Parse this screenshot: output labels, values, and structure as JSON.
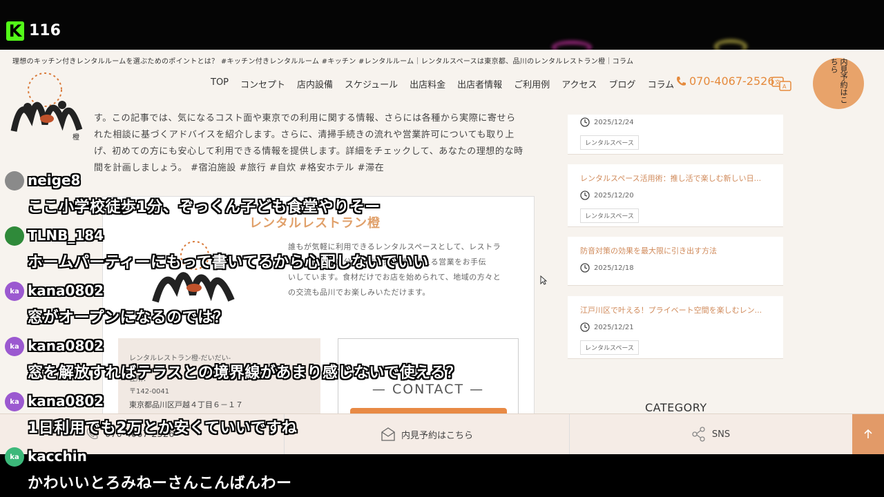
{
  "stream": {
    "viewer_count": "116",
    "logo_letter": "K"
  },
  "site": {
    "breadcrumb": "理想のキッチン付きレンタルルームを選ぶためのポイントとは？ #キッチン付きレンタルルーム #キッチン #レンタルルーム｜レンタルスペースは東京都、品川のレンタルレストラン橙｜コラム",
    "logo_char": "橙",
    "nav": [
      "TOP",
      "コンセプト",
      "店内設備",
      "スケジュール",
      "出店料金",
      "出店者情報",
      "ご利用例",
      "アクセス",
      "ブログ",
      "コラム"
    ],
    "phone": "070-4067-2526",
    "visit_circle": "内見予約はこちら",
    "article_lines": [
      "す。この記事では、気になるコスト面や東京での利用に関する情報、さらには各種から実際に寄せら",
      "れた相談に基づくアドバイスを紹介します。さらに、清掃手続きの流れや営業許可についても取り上",
      "げ、初めての方にも安心して利用できる情報を提供します。詳細をチェックして、あなたの理想的な時",
      "間を計画しましょう。 #宿泊施設 #旅行 #自炊 #格安ホテル #滞在"
    ],
    "shop_card": {
      "title": "レンタルレストラン橙",
      "desc_lines": [
        "誰もが気軽に利用できるレンタルスペースとして、レストラ",
        "ンを出店し、自分のお店を持つ夢を叶える営業をお手伝",
        "いしています。食材だけでお店を始められて、地域の方々と",
        "の交流も品川でお楽しみいただけます。"
      ],
      "addr_name": "レンタルレストラン橙-だいだい-",
      "addr_label": "住所：",
      "addr_zip": "〒142-0041",
      "addr_line": "東京都品川区戸越４丁目６－１７",
      "contact_title": "— CONTACT —"
    },
    "sidebar": [
      {
        "title": "",
        "date": "2025/12/24",
        "tag": "レンタルスペース"
      },
      {
        "title": "レンタルスペース活用術：推し活で楽しむ新しい日...",
        "date": "2025/12/20",
        "tag": "レンタルスペース"
      },
      {
        "title": "防音対策の効果を最大限に引き出す方法",
        "date": "2025/12/18",
        "tag": ""
      },
      {
        "title": "江戸川区で叶える！プライベート空間を楽しむレン...",
        "date": "2025/12/21",
        "tag": "レンタルスペース"
      }
    ],
    "category_heading": "CATEGORY",
    "footer": {
      "phone": "070-4067-2526",
      "visit": "内見予約はこちら",
      "sns": "SNS"
    }
  },
  "chat": [
    {
      "user": "neige8",
      "text": "ここ小学校徒歩1分、ぞっくん子ども食堂やりそー",
      "avatar": "",
      "color": "#8a8a8a"
    },
    {
      "user": "TLNB_184",
      "text": "ホームパーティーにもって書いてるから心配しないでいい",
      "avatar": "",
      "color": "#2f8a3a"
    },
    {
      "user": "kana0802",
      "text": "窓がオープンになるのでは？",
      "avatar": "ka",
      "color": "#9b59d0"
    },
    {
      "user": "kana0802",
      "text": "窓を解放すればテラスとの境界線があまり感じないで使える？",
      "avatar": "ka",
      "color": "#9b59d0"
    },
    {
      "user": "kana0802",
      "text": "1日利用でも2万とか安くていいですね",
      "avatar": "ka",
      "color": "#9b59d0"
    },
    {
      "user": "kacchin",
      "text": "かわいいとろみねーさんこんばんわー",
      "avatar": "ka",
      "color": "#3cb87a"
    }
  ],
  "colors": {
    "accent": "#e88a45",
    "kick_green": "#53fc18",
    "site_bg": "#f7f3ee"
  }
}
